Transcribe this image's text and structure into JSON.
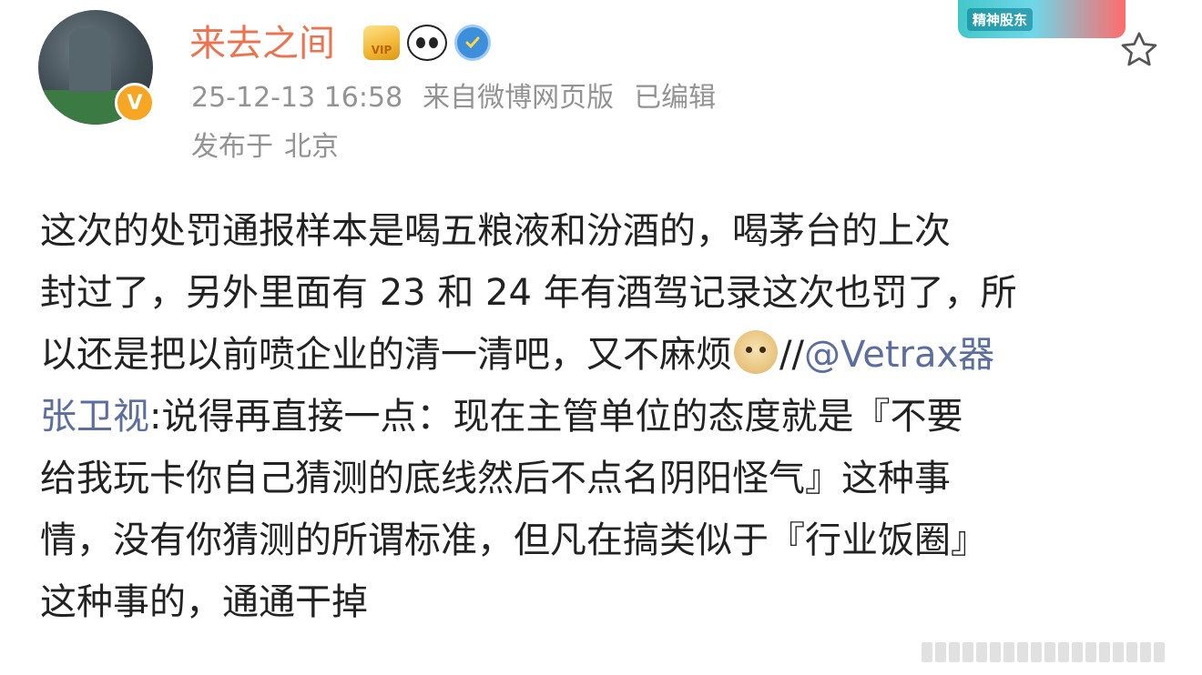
{
  "header": {
    "username": "来去之间",
    "badges": [
      {
        "icon": "vip-crown-icon",
        "text": "VIP"
      },
      {
        "icon": "panda-icon"
      },
      {
        "icon": "shield-icon"
      }
    ],
    "verified_mark": "V",
    "timestamp": "25-12-13 16:58",
    "source": "来自微博网页版",
    "edited": "已编辑",
    "location_prefix": "发布于",
    "location": "北京",
    "promo_text": "精神股东"
  },
  "post": {
    "lines": [
      {
        "text": "这次的处罚通报样本是喝五粮液和汾酒的，喝茅台的上次"
      },
      {
        "text": "封过了，另外里面有 23 和 24 年有酒驾记录这次也罚了，所"
      },
      {
        "text_before": "以还是把以前喷企业的清一清吧，又不麻烦",
        "emoji": "doge-emoji",
        "slashes": "//",
        "mention_part1": "@Vetrax器"
      },
      {
        "mention_part2": "张卫视",
        "text_after": ":说得再直接一点：现在主管单位的态度就是『不要"
      },
      {
        "text": "给我玩卡你自己猜测的底线然后不点名阴阳怪气』这种事"
      },
      {
        "text": "情，没有你猜测的所谓标准，但凡在搞类似于『行业饭圈』"
      },
      {
        "text": "这种事的，通通干掉"
      }
    ]
  },
  "colors": {
    "username": "#eb7350",
    "meta": "#939393",
    "body_text": "#222222",
    "mention": "#5b6e9f",
    "verified": "#f6a623"
  }
}
